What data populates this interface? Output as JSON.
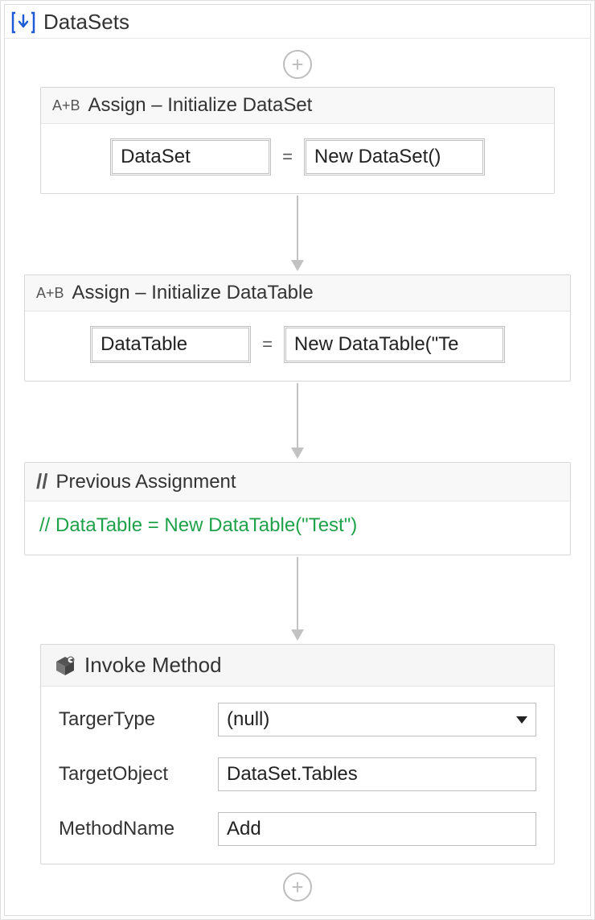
{
  "sequence": {
    "title": "DataSets",
    "activities": [
      {
        "type": "assign",
        "icon": "A+B",
        "title": "Assign – Initialize DataSet",
        "lhs": "DataSet",
        "rhs": "New DataSet()"
      },
      {
        "type": "assign",
        "icon": "A+B",
        "title": "Assign – Initialize DataTable",
        "lhs": "DataTable",
        "rhs": "New DataTable(\"Te"
      },
      {
        "type": "comment",
        "icon": "//",
        "title": "Previous Assignment",
        "text": "// DataTable = New DataTable(\"Test\")"
      },
      {
        "type": "invoke_method",
        "icon": "cube",
        "title": "Invoke Method",
        "rows": [
          {
            "label": "TargerType",
            "control": "select",
            "value": "(null)"
          },
          {
            "label": "TargetObject",
            "control": "text",
            "value": "DataSet.Tables"
          },
          {
            "label": "MethodName",
            "control": "text",
            "value": "Add"
          }
        ]
      }
    ]
  }
}
